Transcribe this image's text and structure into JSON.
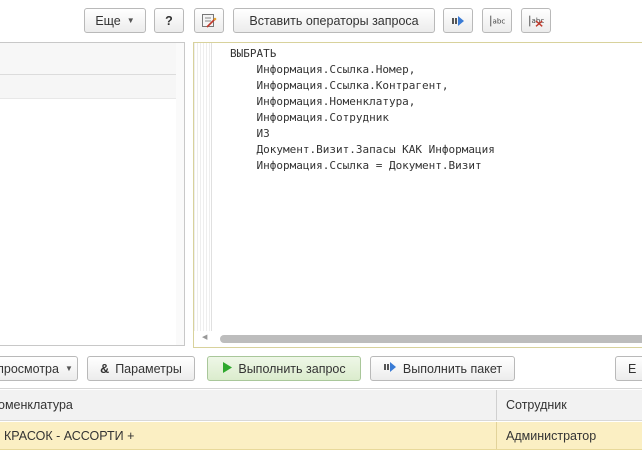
{
  "toolbar_top": {
    "more_label": "Еще",
    "help_label": "?",
    "insert_operators_label": "Вставить операторы запроса"
  },
  "editor": {
    "code": "ВЫБРАТЬ\n    Информация.Ссылка.Номер,\n    Информация.Ссылка.Контрагент,\n    Информация.Номенклатура,\n    Информация.Сотрудник\n    ИЗ\n    Документ.Визит.Запасы КАК Информация\n    Информация.Ссылка = Документ.Визит"
  },
  "toolbar_bottom": {
    "view_mode_label": "просмотра",
    "parameters_label": "Параметры",
    "execute_query_label": "Выполнить запрос",
    "execute_batch_label": "Выполнить пакет",
    "right_cut_label": "Е"
  },
  "result_table": {
    "columns": [
      "оменклатура",
      "Сотрудник"
    ],
    "rows": [
      [
        "КРАСОК - АССОРТИ +",
        "Администратор"
      ]
    ]
  },
  "colors": {
    "selected_row": "#fbefc3",
    "run_green": "#2ea82e",
    "editor_border": "#d8d29c"
  }
}
